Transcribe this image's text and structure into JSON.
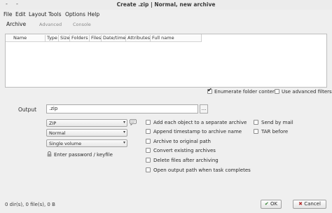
{
  "window": {
    "title": "Create .zip | Normal, new archive",
    "btn_left": "-",
    "btn_right": "-"
  },
  "menu": [
    "File",
    "Edit",
    "Layout",
    "Tools",
    "Options",
    "Help"
  ],
  "tabs": {
    "archive": "Archive",
    "advanced": "Advanced",
    "console": "Console"
  },
  "file_list": {
    "columns": [
      "Name",
      "Type",
      "Size",
      "Folders",
      "Files",
      "Date/time",
      "Attributes",
      "Full name"
    ]
  },
  "options": {
    "enumerate": "Enumerate folder content",
    "advanced_filters": "Use advanced filters"
  },
  "output": {
    "label": "Output",
    "value": ".zip",
    "browse": "..."
  },
  "format": {
    "value": "ZIP"
  },
  "level": {
    "value": "Normal"
  },
  "volume": {
    "value": "Single volume"
  },
  "password": {
    "label": "Enter password / keyfile"
  },
  "checks": {
    "each_object": "Add each object to a separate archive",
    "timestamp": "Append timestamp to archive name",
    "to_original": "Archive to original path",
    "convert": "Convert existing archives",
    "delete": "Delete files after archiving",
    "open_output": "Open output path when task completes",
    "send_mail": "Send by mail",
    "tar_before": "TAR before"
  },
  "status": {
    "text": "0 dir(s), 0 file(s), 0 B"
  },
  "buttons": {
    "ok": "OK",
    "cancel": "Cancel"
  }
}
